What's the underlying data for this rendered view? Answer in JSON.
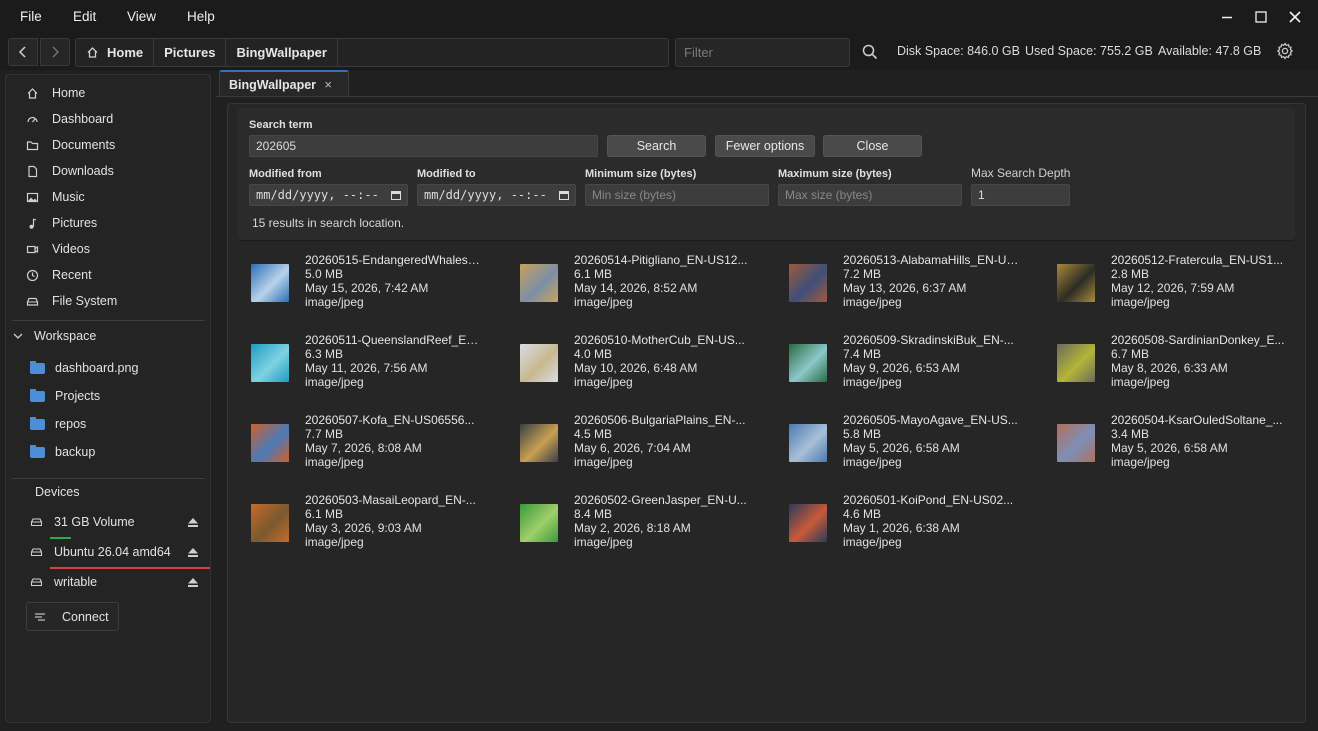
{
  "menu": {
    "file": "File",
    "edit": "Edit",
    "view": "View",
    "help": "Help"
  },
  "toolbar": {
    "breadcrumb": [
      "Home",
      "Pictures",
      "BingWallpaper"
    ],
    "filter_placeholder": "Filter",
    "disk_space": "Disk Space: 846.0 GB",
    "used_space": "Used Space: 755.2 GB",
    "available": "Available: 47.8 GB"
  },
  "sidebar": {
    "places": [
      "Home",
      "Dashboard",
      "Documents",
      "Downloads",
      "Music",
      "Pictures",
      "Videos",
      "Recent",
      "File System"
    ],
    "workspace_title": "Workspace",
    "workspace_items": [
      "dashboard.png",
      "Projects",
      "repos",
      "backup"
    ],
    "devices_title": "Devices",
    "devices": [
      {
        "name": "31 GB Volume",
        "usage": 0.14,
        "color": "#2fa84f"
      },
      {
        "name": "Ubuntu 26.04 amd64",
        "usage": 1.0,
        "color": "#d94040"
      },
      {
        "name": "writable",
        "usage": 0,
        "color": "#2fa84f"
      }
    ],
    "connect_label": "Connect"
  },
  "tab": {
    "label": "BingWallpaper",
    "close": "×"
  },
  "search": {
    "term_label": "Search term",
    "term_value": "202605",
    "search_btn": "Search",
    "fewer_btn": "Fewer options",
    "close_btn": "Close",
    "modified_from_label": "Modified from",
    "modified_from_value": "mm/dd/yyyy, --:-- --",
    "modified_to_label": "Modified to",
    "modified_to_value": "mm/dd/yyyy, --:-- --",
    "min_size_label": "Minimum size (bytes)",
    "min_size_placeholder": "Min size (bytes)",
    "max_size_label": "Maximum size (bytes)",
    "max_size_placeholder": "Max size (bytes)",
    "depth_label": "Max Search Depth",
    "depth_value": "1",
    "results_count": "15 results in search location."
  },
  "results": [
    {
      "name": "20260515-EndangeredWhales_EN-US...",
      "size": "5.0 MB",
      "date": "May 15, 2026, 7:42 AM",
      "type": "image/jpeg",
      "colors": [
        "#2a6fb5",
        "#b9d3ea"
      ]
    },
    {
      "name": "20260514-Pitigliano_EN-US12...",
      "size": "6.1 MB",
      "date": "May 14, 2026, 8:52 AM",
      "type": "image/jpeg",
      "colors": [
        "#c9a25a",
        "#7b8fa8"
      ]
    },
    {
      "name": "20260513-AlabamaHills_EN-US...",
      "size": "7.2 MB",
      "date": "May 13, 2026, 6:37 AM",
      "type": "image/jpeg",
      "colors": [
        "#a05a3a",
        "#3e4f7a"
      ]
    },
    {
      "name": "20260512-Fratercula_EN-US1...",
      "size": "2.8 MB",
      "date": "May 12, 2026, 7:59 AM",
      "type": "image/jpeg",
      "colors": [
        "#a88a3a",
        "#2c2c24"
      ]
    },
    {
      "name": "20260511-QueenslandReef_EN-...",
      "size": "6.3 MB",
      "date": "May 11, 2026, 7:56 AM",
      "type": "image/jpeg",
      "colors": [
        "#1e9bc4",
        "#7fd3e0"
      ]
    },
    {
      "name": "20260510-MotherCub_EN-US...",
      "size": "4.0 MB",
      "date": "May 10, 2026, 6:48 AM",
      "type": "image/jpeg",
      "colors": [
        "#d8dde4",
        "#c8b88e"
      ]
    },
    {
      "name": "20260509-SkradinskiBuk_EN-...",
      "size": "7.4 MB",
      "date": "May 9, 2026, 6:53 AM",
      "type": "image/jpeg",
      "colors": [
        "#2b6a45",
        "#8bc8c8"
      ]
    },
    {
      "name": "20260508-SardinianDonkey_E...",
      "size": "6.7 MB",
      "date": "May 8, 2026, 6:33 AM",
      "type": "image/jpeg",
      "colors": [
        "#6a6a5a",
        "#b5b53a"
      ]
    },
    {
      "name": "20260507-Kofa_EN-US06556...",
      "size": "7.7 MB",
      "date": "May 7, 2026, 8:08 AM",
      "type": "image/jpeg",
      "colors": [
        "#d0602a",
        "#4a7ab8"
      ]
    },
    {
      "name": "20260506-BulgariaPlains_EN-...",
      "size": "4.5 MB",
      "date": "May 6, 2026, 7:04 AM",
      "type": "image/jpeg",
      "colors": [
        "#3a3f48",
        "#c8a050"
      ]
    },
    {
      "name": "20260505-MayoAgave_EN-US...",
      "size": "5.8 MB",
      "date": "May 5, 2026, 6:58 AM",
      "type": "image/jpeg",
      "colors": [
        "#4a7ab0",
        "#a8c0d8"
      ]
    },
    {
      "name": "20260504-KsarOuledSoltane_...",
      "size": "3.4 MB",
      "date": "May 5, 2026, 6:58 AM",
      "type": "image/jpeg",
      "colors": [
        "#b0705a",
        "#7d8fb8"
      ]
    },
    {
      "name": "20260503-MasaiLeopard_EN-...",
      "size": "6.1 MB",
      "date": "May 3, 2026, 9:03 AM",
      "type": "image/jpeg",
      "colors": [
        "#c86a28",
        "#7a5a30"
      ]
    },
    {
      "name": "20260502-GreenJasper_EN-U...",
      "size": "8.4 MB",
      "date": "May 2, 2026, 8:18 AM",
      "type": "image/jpeg",
      "colors": [
        "#3a9a3a",
        "#9fcf6a"
      ]
    },
    {
      "name": "20260501-KoiPond_EN-US02...",
      "size": "4.6 MB",
      "date": "May 1, 2026, 6:38 AM",
      "type": "image/jpeg",
      "colors": [
        "#2a3a5a",
        "#c85a3a"
      ]
    }
  ]
}
